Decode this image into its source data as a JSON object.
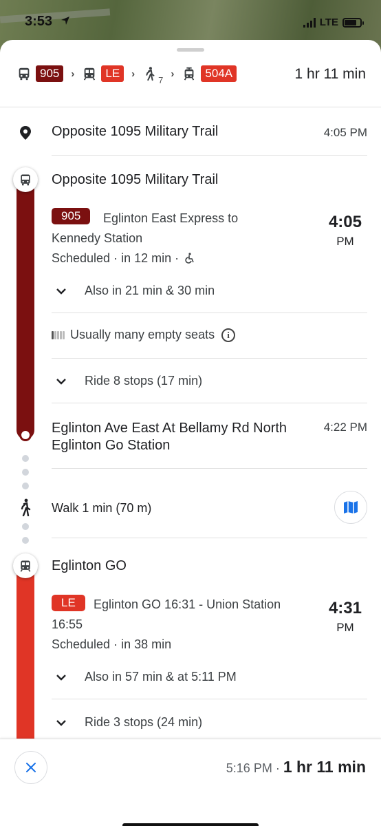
{
  "status": {
    "time": "3:53",
    "network": "LTE",
    "battery_level": 0.75
  },
  "summary": {
    "route_1": "905",
    "route_2": "LE",
    "walk_minutes": "7",
    "route_3": "504A",
    "total": "1 hr 11 min",
    "colors": {
      "route_905": "#7b1010",
      "route_LE": "#e03526",
      "route_504A": "#e03526"
    }
  },
  "origin": {
    "name": "Opposite 1095 Military Trail",
    "time": "4:05 PM"
  },
  "leg1": {
    "stop": "Opposite 1095 Military Trail",
    "route": "905",
    "desc_line1": "Eglinton East Express to",
    "desc_line2": "Kennedy Station",
    "schedule": "Scheduled · in 12 min ·",
    "dep_time": "4:05",
    "dep_ampm": "PM",
    "also": "Also in 21 min & 30 min",
    "seats": "Usually many empty seats",
    "ride": "Ride 8 stops (17 min)",
    "alight_line1": "Eglinton Ave East At Bellamy Rd North",
    "alight_line2": "Eglinton Go Station",
    "alight_time": "4:22 PM"
  },
  "walk": {
    "label": "Walk 1 min (70 m)"
  },
  "leg2": {
    "stop": "Eglinton GO",
    "route": "LE",
    "desc_line1": "Eglinton GO 16:31 - Union Station",
    "desc_line2": "16:55",
    "schedule": "Scheduled · in 38 min",
    "dep_time": "4:31",
    "dep_ampm": "PM",
    "also": "Also in 57 min & at 5:11 PM",
    "ride": "Ride 3 stops (24 min)"
  },
  "footer": {
    "arrive": "5:16 PM",
    "separator": "·",
    "total": "1 hr 11 min"
  }
}
